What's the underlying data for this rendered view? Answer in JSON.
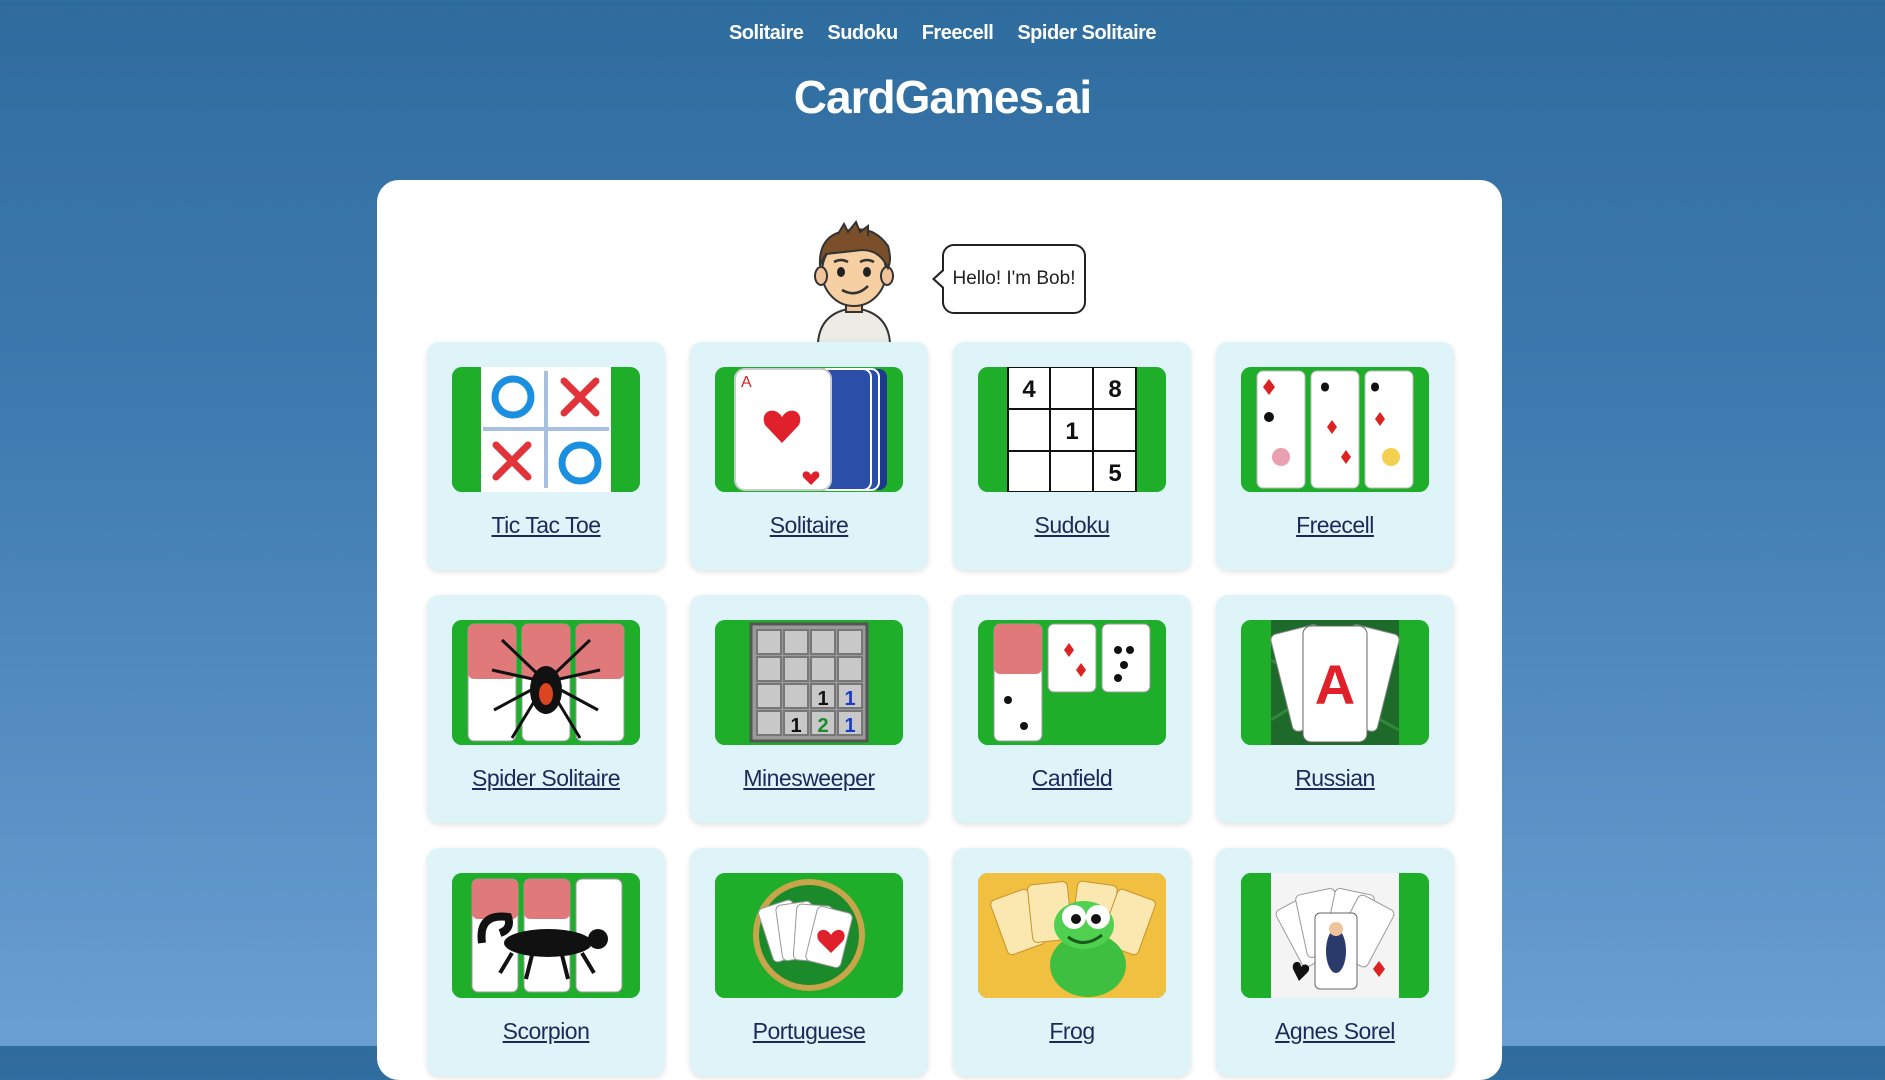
{
  "nav": [
    "Solitaire",
    "Sudoku",
    "Freecell",
    "Spider Solitaire"
  ],
  "site_title": "CardGames.ai",
  "bob": {
    "greeting": "Hello! I'm Bob!"
  },
  "games": [
    {
      "label": "Tic Tac Toe",
      "icon": "tic-tac-toe-icon"
    },
    {
      "label": "Solitaire",
      "icon": "solitaire-icon"
    },
    {
      "label": "Sudoku",
      "icon": "sudoku-icon"
    },
    {
      "label": "Freecell",
      "icon": "freecell-icon"
    },
    {
      "label": "Spider Solitaire",
      "icon": "spider-solitaire-icon"
    },
    {
      "label": "Minesweeper",
      "icon": "minesweeper-icon"
    },
    {
      "label": "Canfield",
      "icon": "canfield-icon"
    },
    {
      "label": "Russian",
      "icon": "russian-icon"
    },
    {
      "label": "Scorpion",
      "icon": "scorpion-icon"
    },
    {
      "label": "Portuguese",
      "icon": "portuguese-icon"
    },
    {
      "label": "Frog",
      "icon": "frog-icon"
    },
    {
      "label": "Agnes Sorel",
      "icon": "agnes-sorel-icon"
    }
  ],
  "thumb_text": {
    "sudoku": [
      "4",
      "8",
      "1",
      "5"
    ],
    "minesweeper": [
      "1",
      "1",
      "1",
      "2",
      "1"
    ],
    "russian_card": "A"
  },
  "colors": {
    "accent_green": "#1fae2a",
    "card_bg": "#def4f8",
    "link": "#1c2a5a",
    "xo_red": "#e0343a",
    "xo_blue": "#1b8fe0"
  }
}
